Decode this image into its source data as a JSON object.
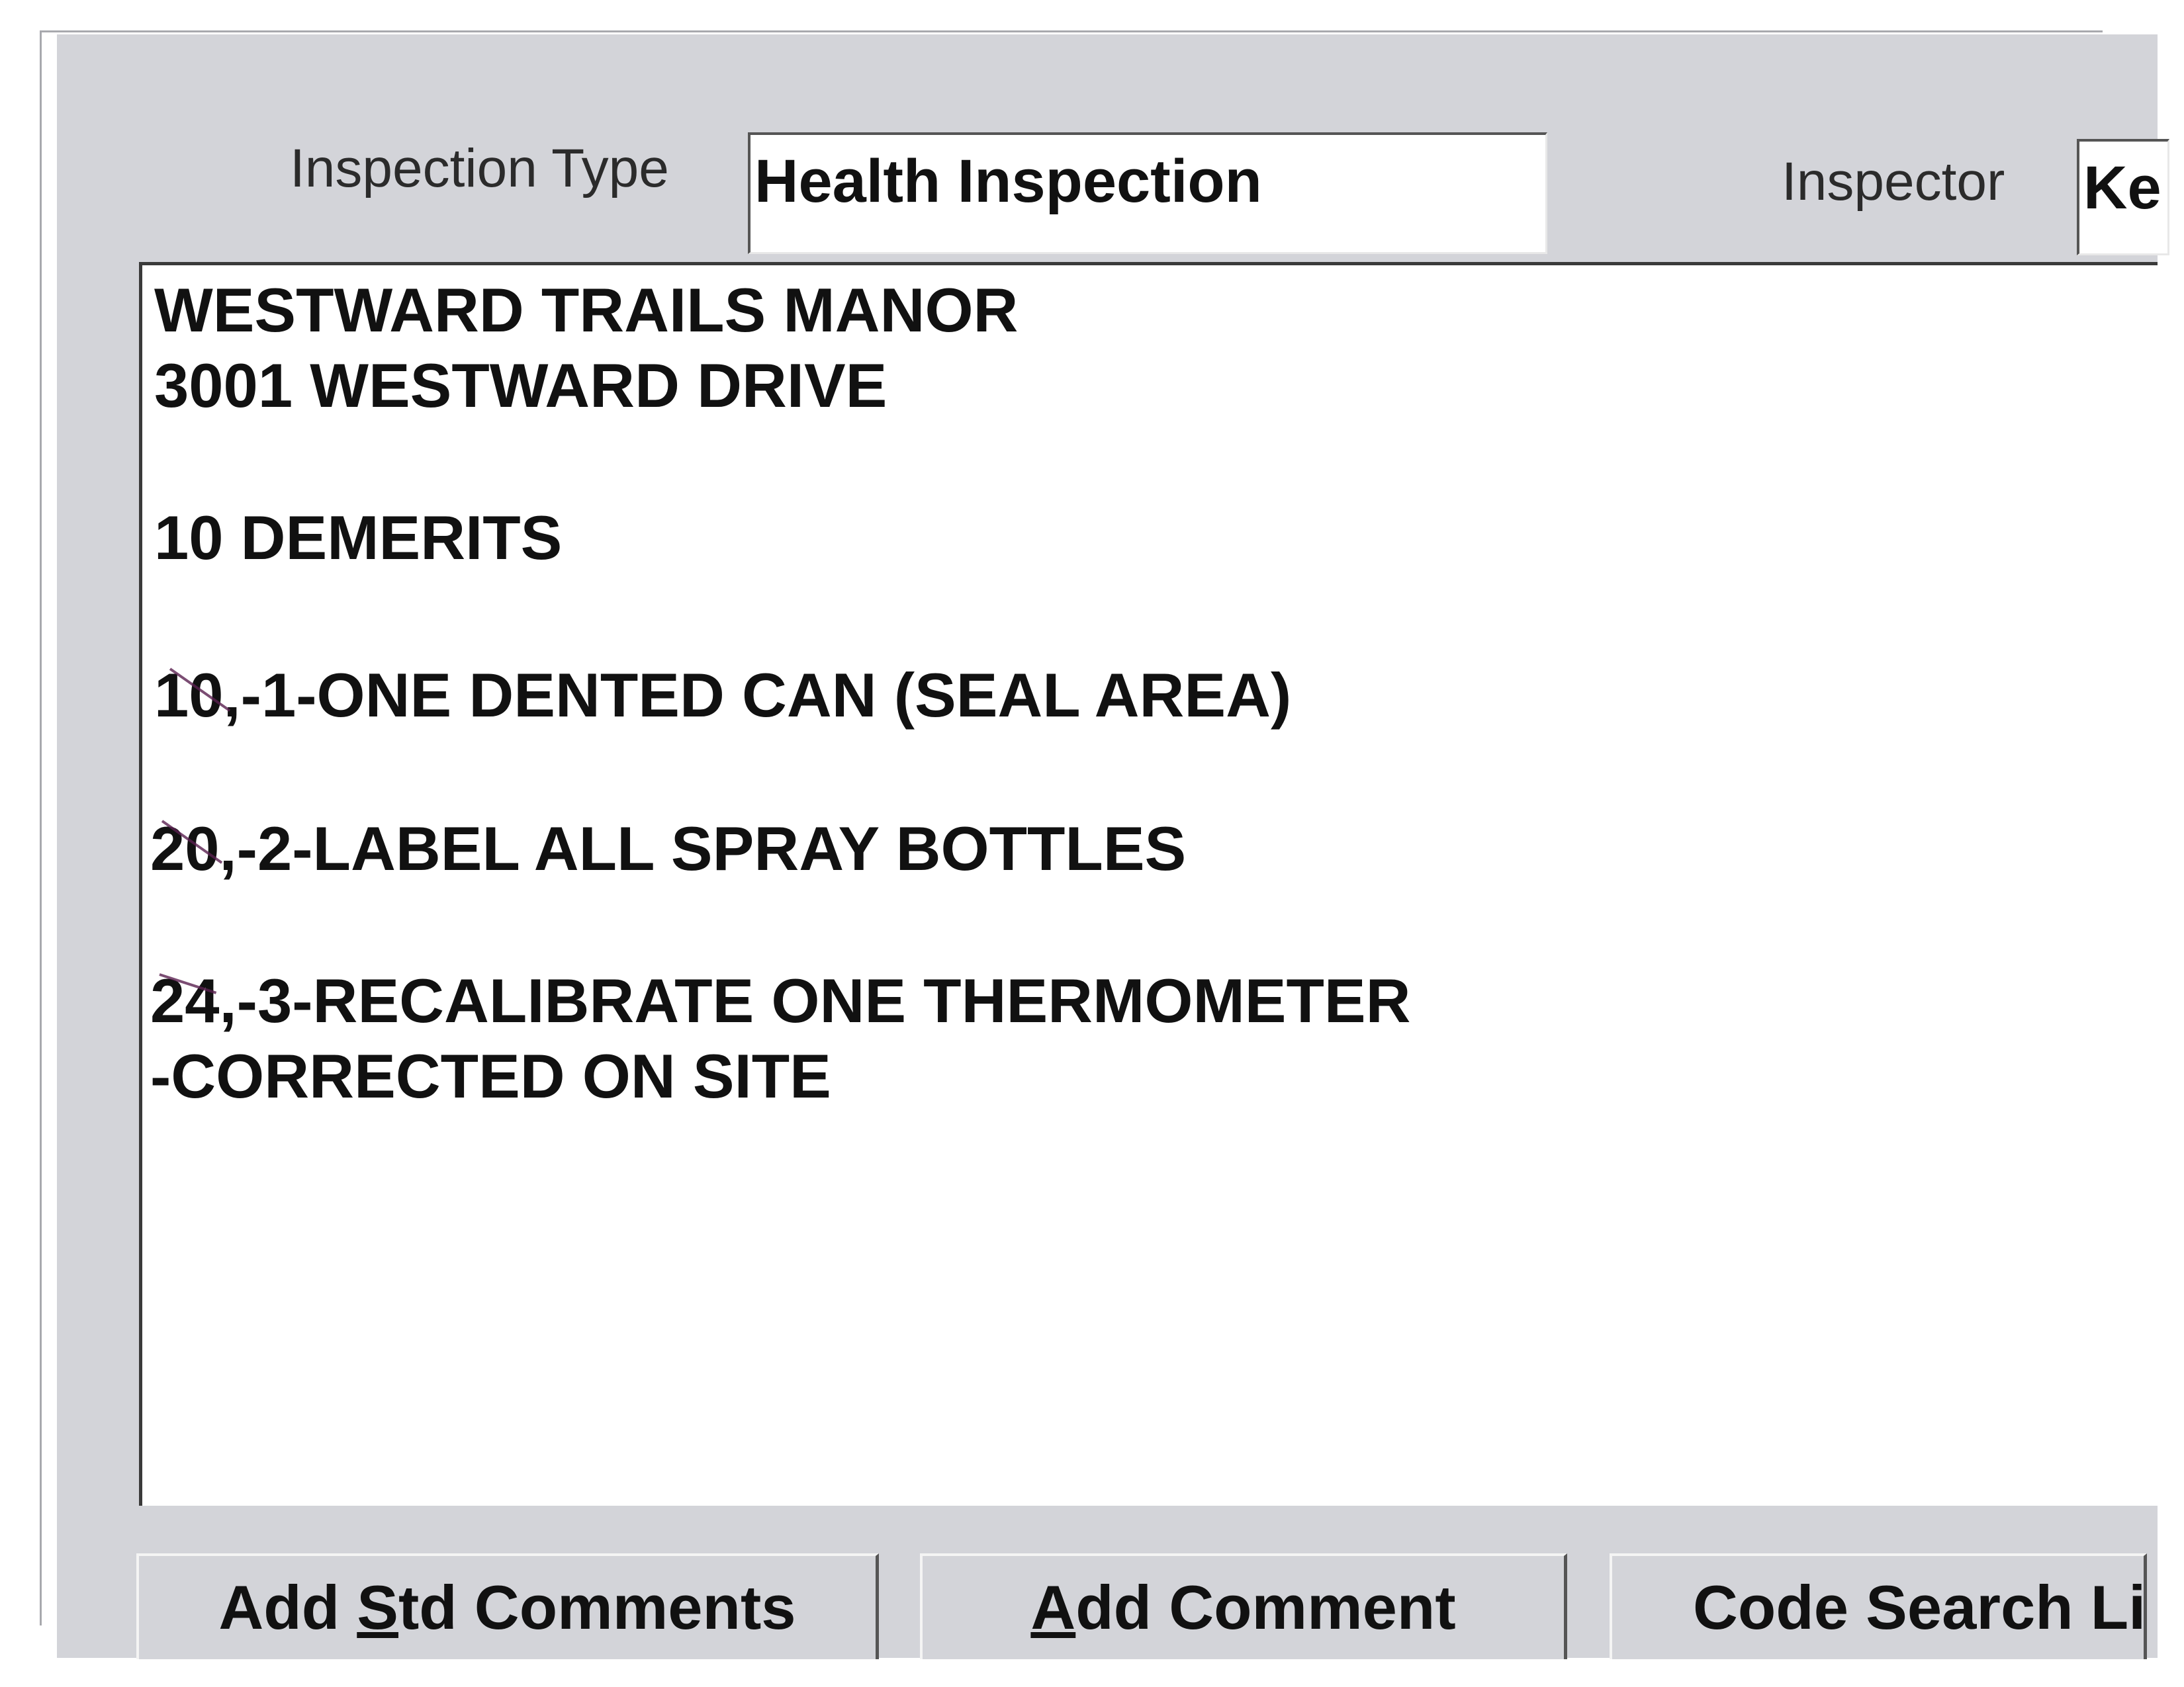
{
  "inspection_type": {
    "label": "Inspection Type",
    "value": "Health Inspection"
  },
  "inspector": {
    "label": "Inspector",
    "value": "Ke"
  },
  "comments": {
    "lines": [
      "WESTWARD TRAILS MANOR",
      "3001 WESTWARD DRIVE",
      "10 DEMERITS",
      "10,-1-ONE DENTED CAN (SEAL AREA)",
      "20,-2-LABEL ALL SPRAY BOTTLES",
      "24,-3-RECALIBRATE ONE THERMOMETER",
      "-CORRECTED ON SITE"
    ]
  },
  "buttons": {
    "add_std_comments": {
      "pre": "Add ",
      "accel": "S",
      "post": "td Comments"
    },
    "add_comment": {
      "pre": "",
      "accel": "A",
      "post": "dd Comment"
    },
    "code_search": {
      "label": "Code Search Li"
    }
  }
}
